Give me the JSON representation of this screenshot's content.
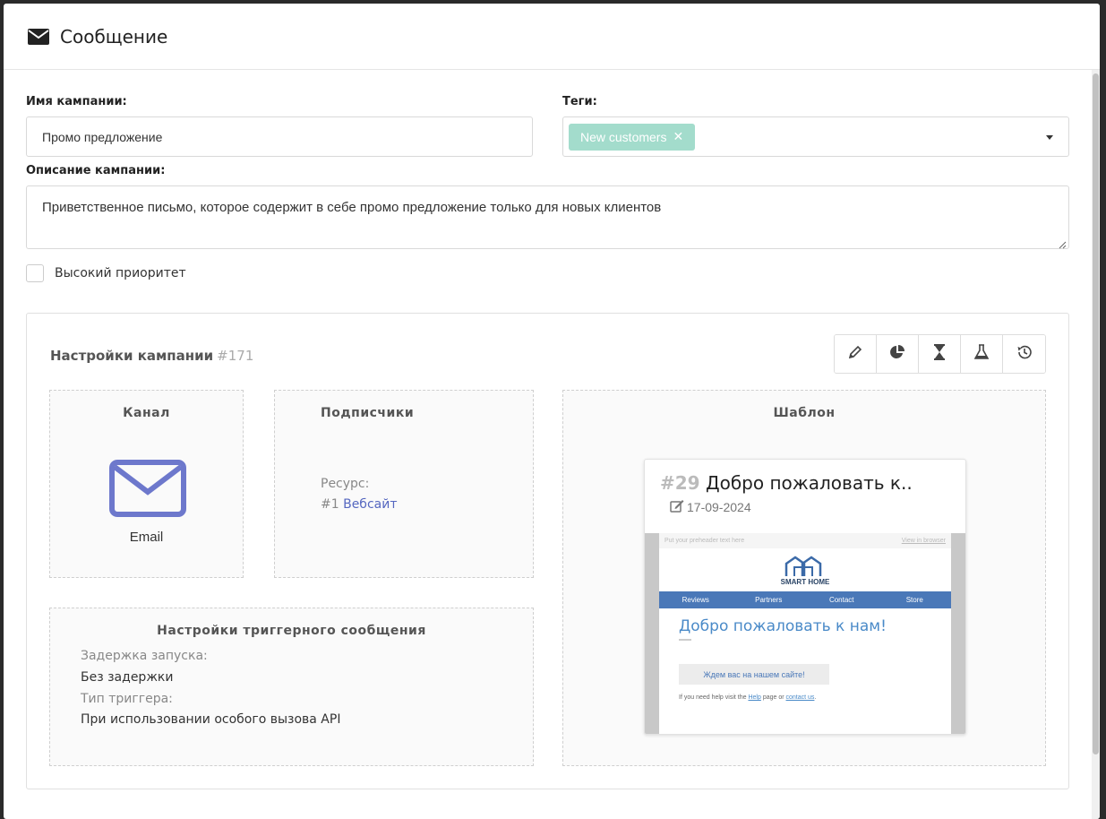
{
  "modal": {
    "title": "Сообщение",
    "icon": "envelope-icon"
  },
  "campaign_name": {
    "label": "Имя кампании:",
    "value": "Промо предложение"
  },
  "tags": {
    "label": "Теги:",
    "chips": [
      {
        "label": "New customers",
        "remove": "✕"
      }
    ],
    "chip_color": "#a3dccc"
  },
  "description": {
    "label": "Описание кампании:",
    "value": "Приветственное письмо, которое содержит в себе промо предложение только для новых клиентов"
  },
  "priority": {
    "label": "Высокий приоритет",
    "checked": false
  },
  "settings": {
    "title": "Настройки кампании",
    "id": "#171",
    "toolbar": [
      {
        "icon": "pencil-icon"
      },
      {
        "icon": "pie-chart-icon"
      },
      {
        "icon": "hourglass-icon"
      },
      {
        "icon": "flask-icon"
      },
      {
        "icon": "history-icon"
      }
    ],
    "channel": {
      "title": "Канал",
      "icon": "envelope-icon",
      "icon_color": "#6d78cc",
      "label": "Email"
    },
    "subscribers": {
      "title": "Подписчики",
      "resource_label": "Ресурс:",
      "resource_id": "#1",
      "resource_name": "Вебсайт"
    },
    "trigger": {
      "title": "Настройки триггерного сообщения",
      "delay_label": "Задержка запуска:",
      "delay_value": "Без задержки",
      "type_label": "Тип триггера:",
      "type_value": "При использовании особого вызова API"
    },
    "template": {
      "title": "Шаблон",
      "number": "#29",
      "name": "Добро пожаловать к..",
      "date": "17-09-2024",
      "preview": {
        "preheader": "Put your preheader text here",
        "view_in_browser": "View in browser",
        "brand": "SMART HOME",
        "nav": [
          "Reviews",
          "Partners",
          "Contact",
          "Store"
        ],
        "heading": "Добро пожаловать к нам!",
        "button": "Ждем вас на нашем сайте!",
        "help_prefix": "If you need help visit the",
        "help_link1": "Help",
        "help_middle": "page or",
        "help_link2": "contact us",
        "help_suffix": "."
      }
    }
  }
}
